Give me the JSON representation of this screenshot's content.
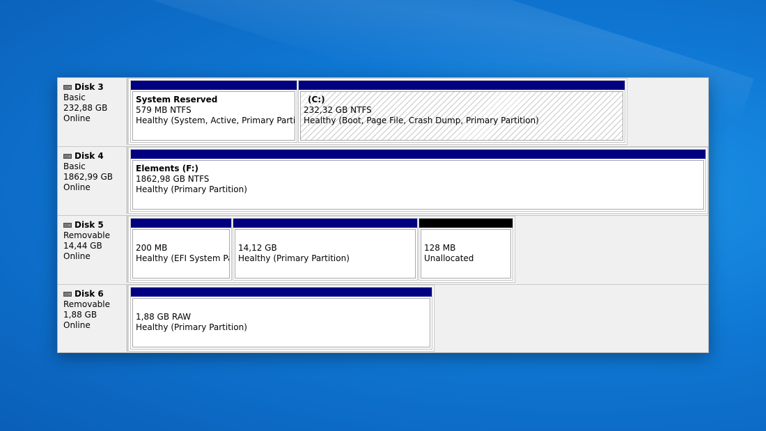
{
  "disks": [
    {
      "name": "Disk 3",
      "type": "Basic",
      "size": "232,88 GB",
      "status": "Online",
      "partitions": [
        {
          "title": "System Reserved",
          "size": "579 MB NTFS",
          "status": "Healthy (System, Active, Primary Partition)"
        },
        {
          "title": "(C:)",
          "size": "232,32 GB NTFS",
          "status": "Healthy (Boot, Page File, Crash Dump, Primary Partition)"
        }
      ]
    },
    {
      "name": "Disk 4",
      "type": "Basic",
      "size": "1862,99 GB",
      "status": "Online",
      "partitions": [
        {
          "title": "Elements  (F:)",
          "size": "1862,98 GB NTFS",
          "status": "Healthy (Primary Partition)"
        }
      ]
    },
    {
      "name": "Disk 5",
      "type": "Removable",
      "size": "14,44 GB",
      "status": "Online",
      "partitions": [
        {
          "size": "200 MB",
          "status": "Healthy (EFI System Partition)"
        },
        {
          "size": "14,12 GB",
          "status": "Healthy (Primary Partition)"
        },
        {
          "size": "128 MB",
          "status": "Unallocated"
        }
      ]
    },
    {
      "name": "Disk 6",
      "type": "Removable",
      "size": "1,88 GB",
      "status": "Online",
      "partitions": [
        {
          "size": "1,88 GB RAW",
          "status": "Healthy (Primary Partition)"
        }
      ]
    }
  ],
  "colors": {
    "primary_bar": "#000080",
    "unallocated_bar": "#000000"
  },
  "icons": {
    "disk": "disk-drive-icon"
  }
}
